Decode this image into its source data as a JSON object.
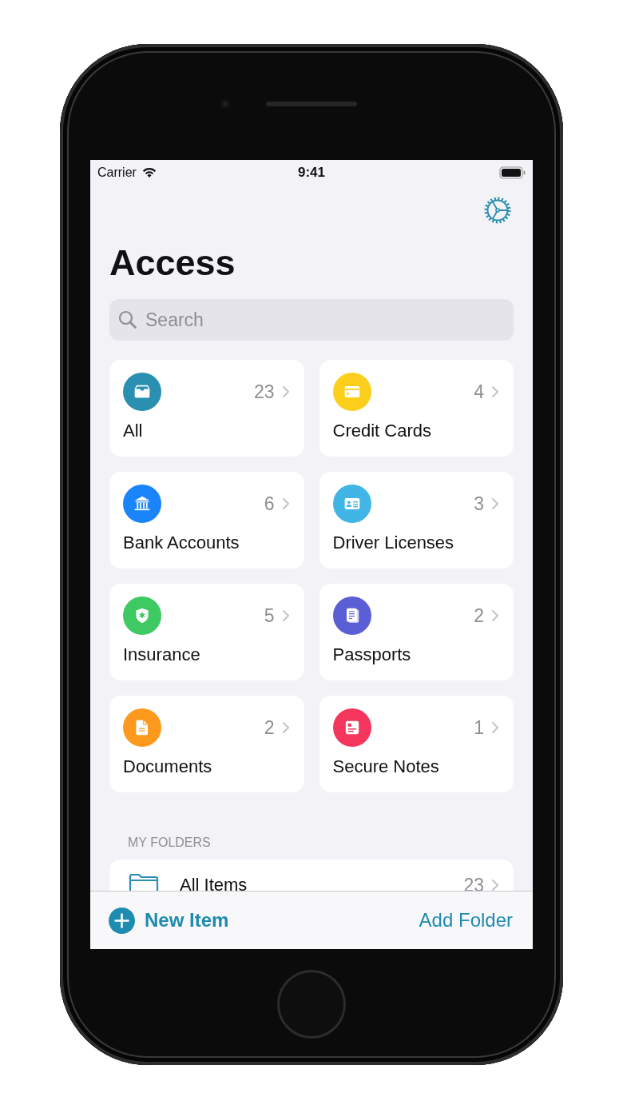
{
  "status_bar": {
    "carrier": "Carrier",
    "time": "9:41"
  },
  "title": "Access",
  "search": {
    "placeholder": "Search"
  },
  "categories": [
    {
      "kind": "tray",
      "label": "All",
      "count": "23",
      "color": "#2a8fb0"
    },
    {
      "kind": "card",
      "label": "Credit Cards",
      "count": "4",
      "color": "#fccf1c"
    },
    {
      "kind": "bank",
      "label": "Bank Accounts",
      "count": "6",
      "color": "#1a84fb"
    },
    {
      "kind": "id",
      "label": "Driver Licenses",
      "count": "3",
      "color": "#40b5e6"
    },
    {
      "kind": "shield",
      "label": "Insurance",
      "count": "5",
      "color": "#3ec962"
    },
    {
      "kind": "pages",
      "label": "Passports",
      "count": "2",
      "color": "#5b5fd6"
    },
    {
      "kind": "document",
      "label": "Documents",
      "count": "2",
      "color": "#fd9a1d"
    },
    {
      "kind": "note",
      "label": "Secure Notes",
      "count": "1",
      "color": "#f5365c"
    }
  ],
  "folders_header": "MY FOLDERS",
  "folders": [
    {
      "label": "All Items",
      "count": "23"
    }
  ],
  "toolbar": {
    "new_item": "New Item",
    "add_folder": "Add Folder"
  }
}
